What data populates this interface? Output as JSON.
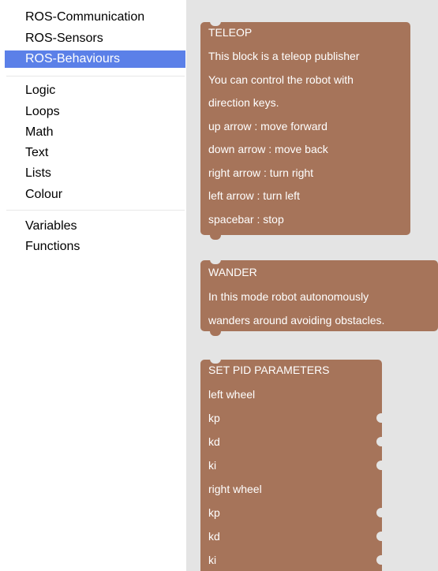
{
  "toolbox": {
    "group1": [
      "ROS-Communication",
      "ROS-Sensors",
      "ROS-Behaviours"
    ],
    "group2": [
      "Logic",
      "Loops",
      "Math",
      "Text",
      "Lists",
      "Colour"
    ],
    "group3": [
      "Variables",
      "Functions"
    ],
    "selected": "ROS-Behaviours"
  },
  "blocks": {
    "teleop": {
      "title": "TELEOP",
      "lines": [
        "This block is a teleop publisher",
        "You can control the robot with",
        "direction keys.",
        "up arrow : move forward",
        "down arrow : move back",
        "right arrow : turn right",
        "left arrow : turn left",
        "spacebar : stop"
      ]
    },
    "wander": {
      "title": "WANDER",
      "lines": [
        "In this mode robot autonomously",
        "wanders around avoiding obstacles."
      ]
    },
    "pid": {
      "title": "SET PID PARAMETERS",
      "lines": [
        "left wheel",
        "kp",
        "kd",
        "ki",
        "right wheel",
        "kp",
        "kd",
        "ki"
      ]
    }
  },
  "colors": {
    "block": "#a6745a",
    "selected": "#5b80e8",
    "workspace": "#e4e4e4"
  }
}
